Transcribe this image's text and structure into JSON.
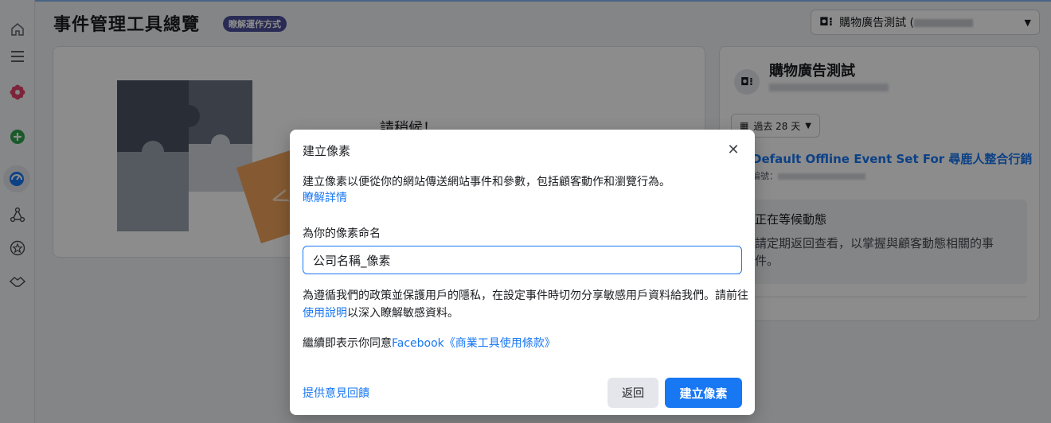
{
  "header": {
    "title": "事件管理工具總覽",
    "learn_badge": "瞭解運作方式",
    "account_label": "購物廣告測試 (",
    "account_icon": "business-account-icon"
  },
  "rail": {
    "items": [
      "home-icon",
      "menu-icon",
      "flower-icon",
      "add-circle-icon",
      "dashboard-icon",
      "connections-icon",
      "star-badge-icon",
      "handshake-icon"
    ]
  },
  "main": {
    "wait_text": "請稍候！"
  },
  "side_card": {
    "title": "購物廣告測試",
    "date_range": "過去 28 天",
    "event_set_link": "Default Offline Event Set For 尋鹿人整合行銷",
    "id_prefix": "編號：",
    "waiting_title": "正在等候動態",
    "waiting_desc": "請定期返回查看，以掌握與顧客動態相關的事件。"
  },
  "modal": {
    "title": "建立像素",
    "description": "建立像素以便從你的網站傳送網站事件和參數，包括顧客動作和瀏覽行為。",
    "learn_more": "瞭解詳情",
    "name_label": "為你的像素命名",
    "name_value": "公司名稱_像素",
    "privacy_pre": "為遵循我們的政策並保護用戶的隱私，在設定事件時切勿分享敏感用戶資料給我們。請前往",
    "privacy_link": "使用說明",
    "privacy_post": "以深入瞭解敏感資料。",
    "terms_pre": "繼續即表示你同意",
    "terms_link": "Facebook《商業工具使用條款》",
    "feedback": "提供意見回饋",
    "back_button": "返回",
    "create_button": "建立像素"
  },
  "colors": {
    "accent": "#1877f2",
    "badge": "#4b4f9c"
  }
}
